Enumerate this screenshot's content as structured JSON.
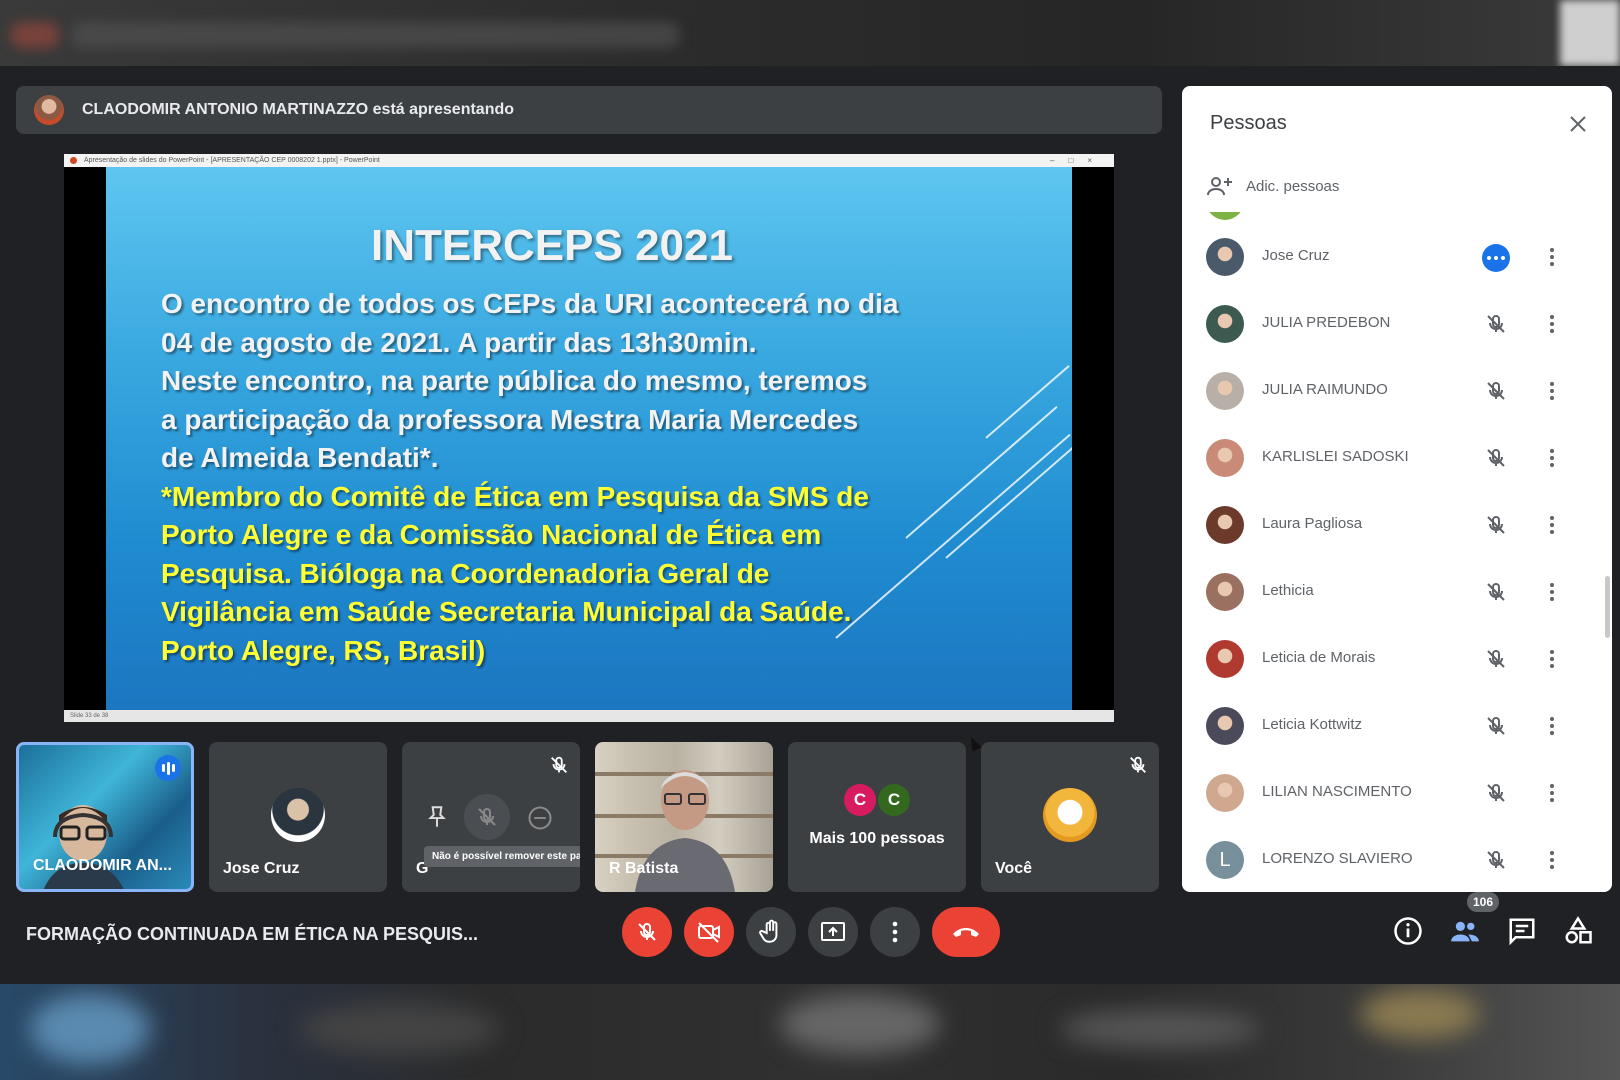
{
  "presenter": {
    "text": "CLAODOMIR ANTONIO MARTINAZZO está apresentando"
  },
  "powerpoint": {
    "window_title": "Apresentação de slides do PowerPoint - [APRESENTAÇÃO CEP 0008202 1.pptx] - PowerPoint",
    "status": "Slide 33 de 38"
  },
  "slide": {
    "title": "INTERCEPS 2021",
    "white_lines": [
      "O encontro de todos os CEPs da URI acontecerá no dia",
      "04 de agosto de 2021. A partir das 13h30min.",
      "Neste encontro, na parte pública do mesmo, teremos",
      "a participação da professora Mestra Maria Mercedes",
      "de Almeida Bendati*."
    ],
    "yellow_lines": [
      "*Membro do Comitê de Ética em Pesquisa da SMS de",
      "Porto Alegre e da Comissão Nacional de Ética em",
      "Pesquisa. Bióloga na Coordenadoria Geral de",
      "Vigilância em Saúde Secretaria Municipal da Saúde.",
      "Porto Alegre, RS, Brasil)"
    ]
  },
  "tiles": [
    {
      "name": "CLAODOMIR AN...",
      "state": "speaking"
    },
    {
      "name": "Jose Cruz",
      "state": "video-off"
    },
    {
      "name": "G",
      "state": "muted-hover",
      "tooltip": "Não é possível remover este participante"
    },
    {
      "name": "R Batista",
      "state": "video"
    },
    {
      "name": "Mais 100 pessoas",
      "state": "overflow",
      "avatars": [
        "C",
        "C"
      ]
    },
    {
      "name": "Você",
      "state": "muted"
    }
  ],
  "people_panel": {
    "title": "Pessoas",
    "add_label": "Adic. pessoas",
    "participants": [
      {
        "name": "Jose Cruz",
        "status": "more-options",
        "avatar_color": "#4a5a6a"
      },
      {
        "name": "JULIA PREDEBON",
        "status": "muted",
        "avatar_color": "#3d5a50"
      },
      {
        "name": "JULIA RAIMUNDO",
        "status": "muted",
        "avatar_color": "#b8b0a8"
      },
      {
        "name": "KARLISLEI SADOSKI",
        "status": "muted",
        "avatar_color": "#c98a78"
      },
      {
        "name": "Laura Pagliosa",
        "status": "muted",
        "avatar_color": "#6b3a2a"
      },
      {
        "name": "Lethicia",
        "status": "muted",
        "avatar_color": "#9a7060"
      },
      {
        "name": "Leticia de Morais",
        "status": "muted",
        "avatar_color": "#b03a30"
      },
      {
        "name": "Leticia Kottwitz",
        "status": "muted",
        "avatar_color": "#4a4a5a"
      },
      {
        "name": "LILIAN NASCIMENTO",
        "status": "muted",
        "avatar_color": "#d0a890"
      },
      {
        "name": "LORENZO SLAVIERO",
        "status": "muted",
        "avatar_color": "#78909c",
        "initial": "L"
      }
    ]
  },
  "meeting": {
    "title": "FORMAÇÃO CONTINUADA EM ÉTICA NA PESQUIS...",
    "participant_count": "106"
  },
  "colors": {
    "accent_blue": "#1a73e8",
    "red": "#ea4335",
    "dark_bg": "#202124",
    "tile_bg": "#3c4043",
    "slide_yellow": "#ffff33"
  }
}
